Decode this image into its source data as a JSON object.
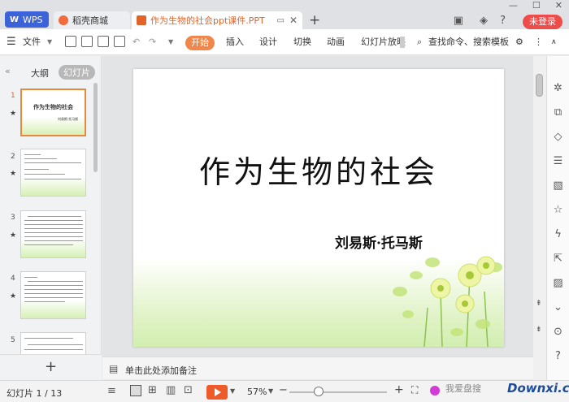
{
  "tabs": {
    "wps": "WPS",
    "shop": "稻壳商城",
    "doc": "作为生物的社会ppt课件.PPT"
  },
  "topright": {
    "login": "未登录"
  },
  "toolbar": {
    "file": "文件",
    "start": "开始",
    "insert": "插入",
    "design": "设计",
    "switch": "切换",
    "animation": "动画",
    "slideshow": "幻灯片放映",
    "search": "查找命令、搜索模板"
  },
  "panel": {
    "outline": "大纲",
    "slides": "幻灯片",
    "thumbs": [
      "1",
      "2",
      "3",
      "4",
      "5"
    ],
    "thumb1_title": "作为生物的社会",
    "thumb1_author": "刘易斯·托马斯"
  },
  "slide": {
    "title": "作为生物的社会",
    "author": "刘易斯·托马斯"
  },
  "notes": {
    "placeholder": "单击此处添加备注"
  },
  "status": {
    "slide_count": "幻灯片 1 / 13",
    "zoom": "57%"
  },
  "watermark": {
    "text": "我爱盘搜",
    "brand": "Downxi.com"
  },
  "colors": {
    "accent": "#e2642a",
    "start_button": "#f0864a",
    "login": "#ee4b4b"
  }
}
